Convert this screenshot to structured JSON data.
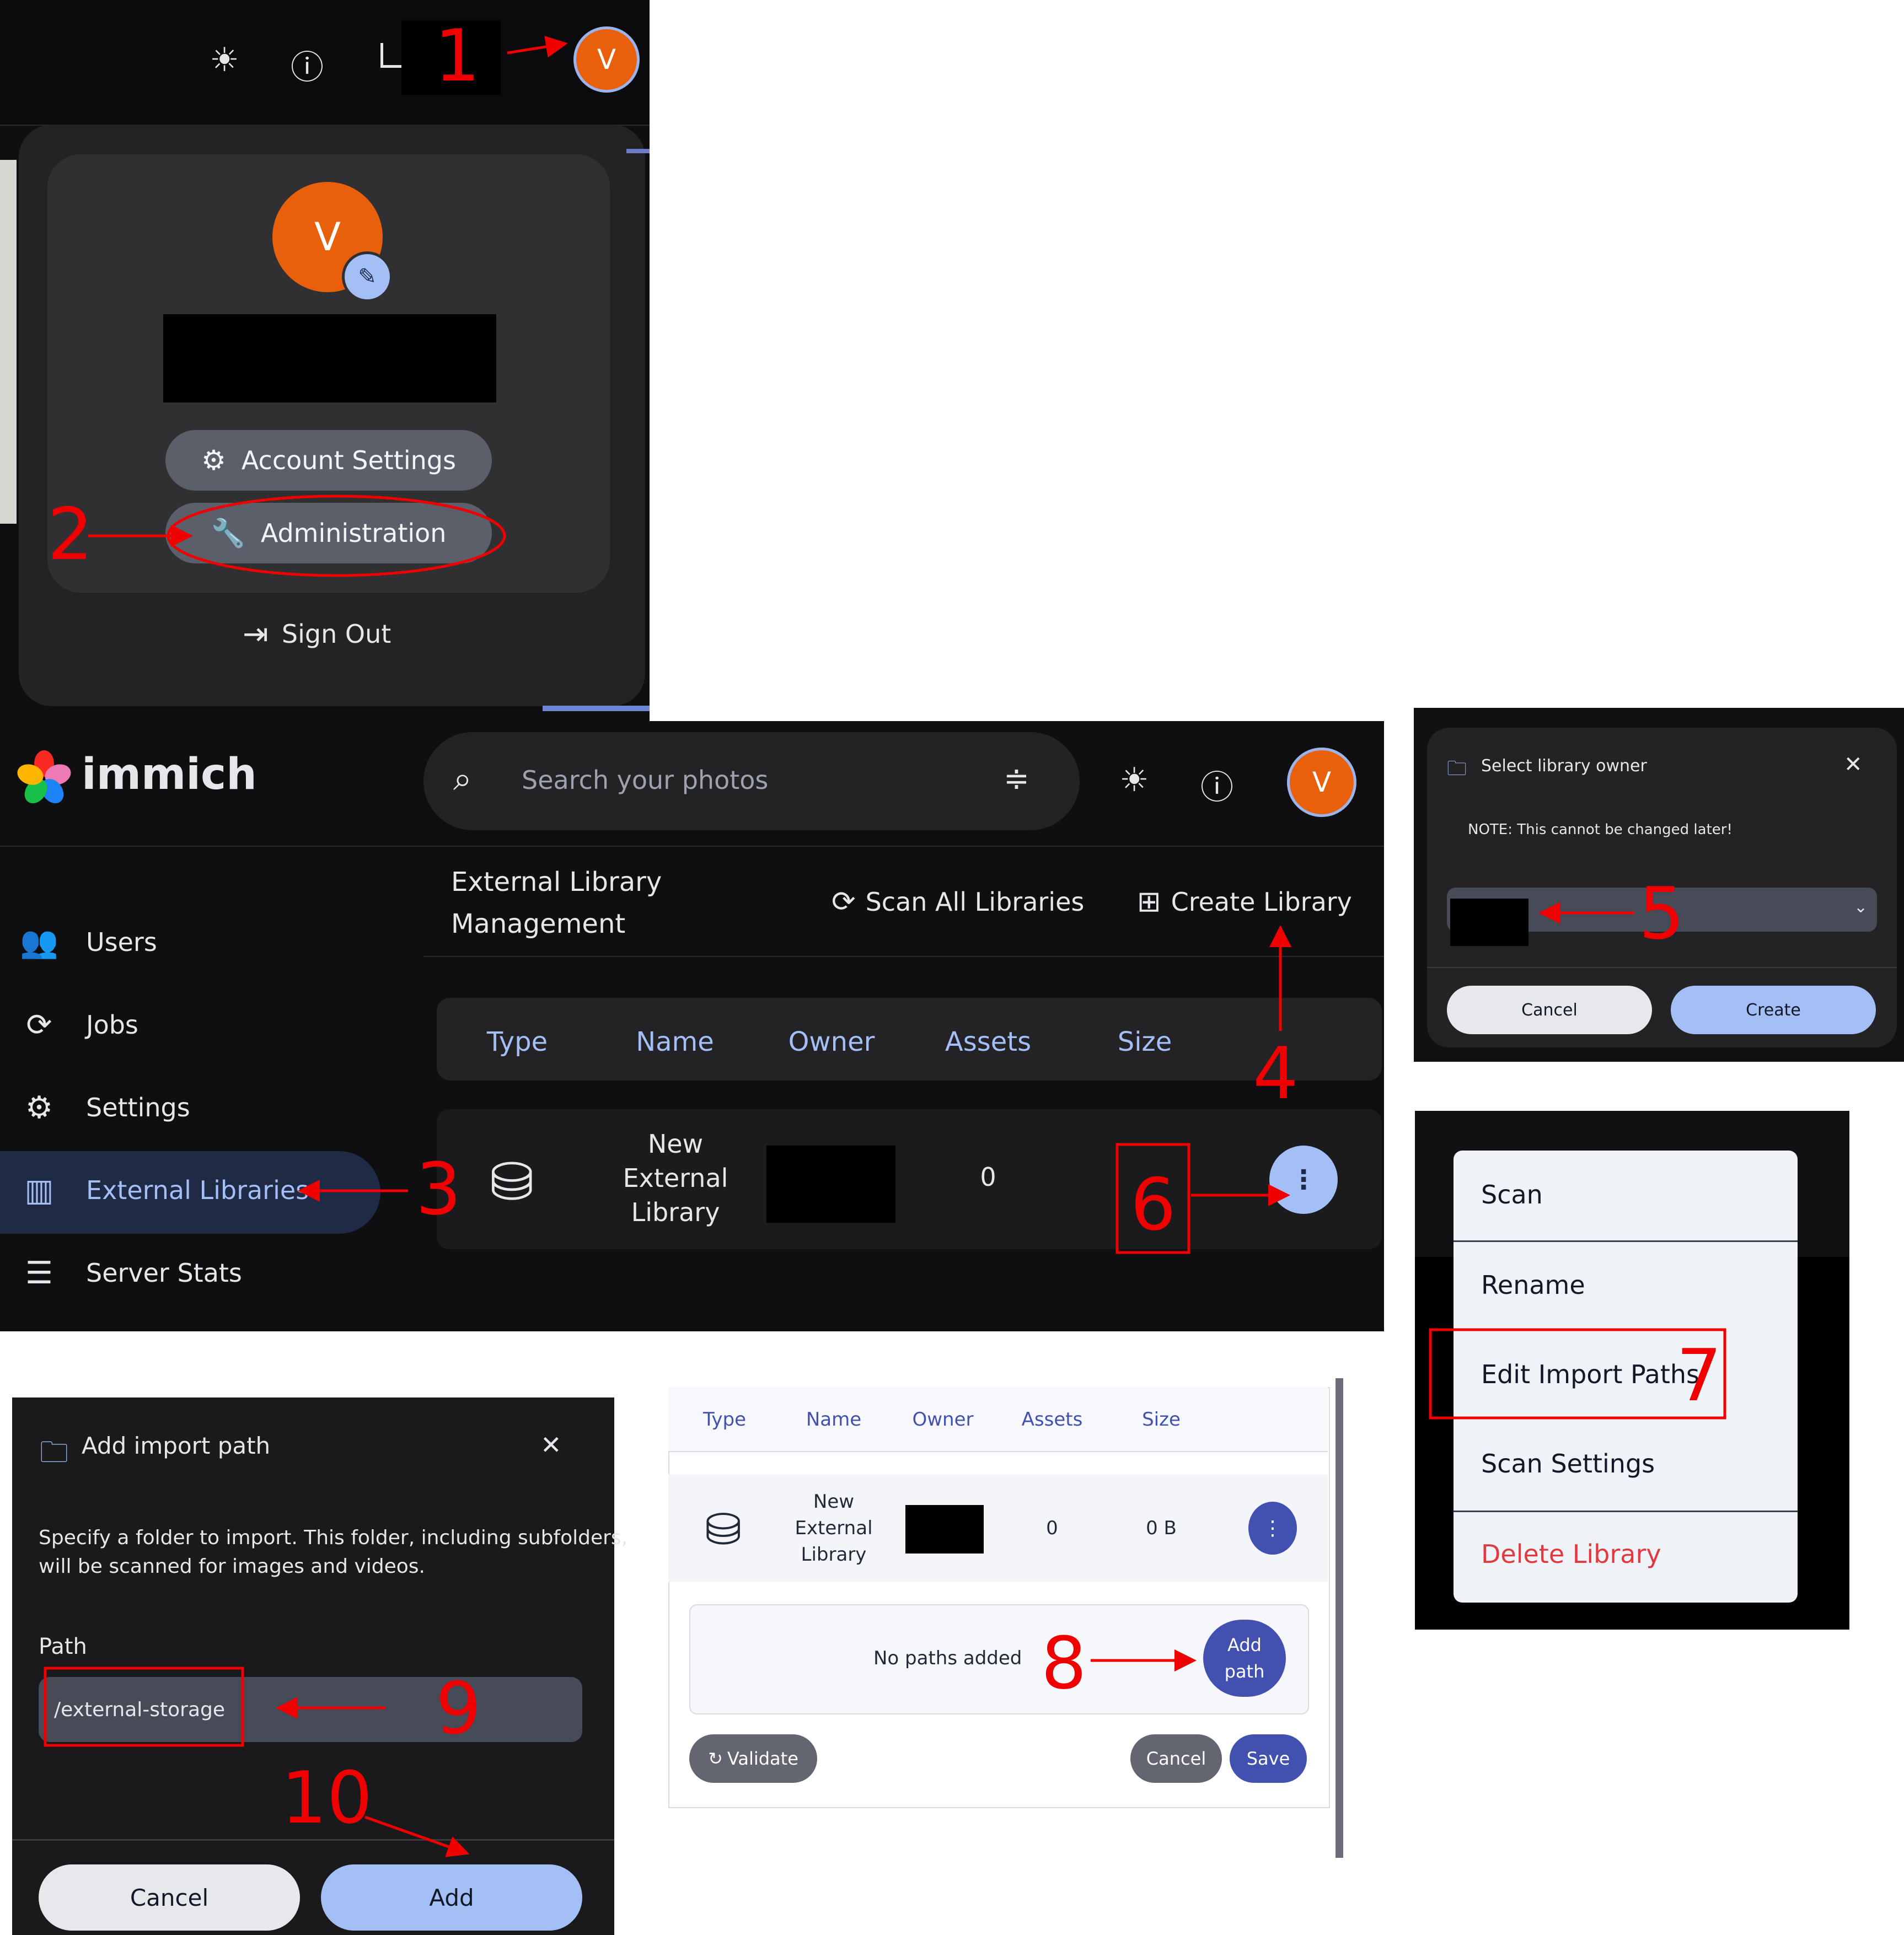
{
  "panel1": {
    "avatar_initial": "V",
    "big_avatar_initial": "V",
    "pencil_icon": "✎",
    "account_settings_label": "Account Settings",
    "administration_label": "Administration",
    "sign_out_label": "Sign Out"
  },
  "panel2": {
    "logo_text": "immich",
    "search_placeholder": "Search your photos",
    "avatar_initial": "V",
    "page_title_line1": "External Library",
    "page_title_line2": "Management",
    "scan_all_label": "Scan All Libraries",
    "create_library_label": "Create Library",
    "sidebar": [
      {
        "label": "Users",
        "icon": "users-icon"
      },
      {
        "label": "Jobs",
        "icon": "sync-icon"
      },
      {
        "label": "Settings",
        "icon": "gear-icon"
      },
      {
        "label": "External Libraries",
        "icon": "library-icon"
      },
      {
        "label": "Server Stats",
        "icon": "server-icon"
      }
    ],
    "columns": [
      "Type",
      "Name",
      "Owner",
      "Assets",
      "Size"
    ],
    "row": {
      "name_line1": "New",
      "name_line2": "External",
      "name_line3": "Library",
      "assets": "0"
    }
  },
  "panel3": {
    "title": "Select library owner",
    "note": "NOTE: This cannot be changed later!",
    "cancel": "Cancel",
    "create": "Create"
  },
  "panel4": {
    "items": [
      "Scan",
      "Rename",
      "Edit Import Paths",
      "Scan Settings",
      "Delete Library"
    ],
    "delete_color": "#e0393e"
  },
  "panel5": {
    "title": "Add import path",
    "desc_line1": "Specify a folder to import. This folder, including subfolders,",
    "desc_line2": "will be scanned for images and videos.",
    "path_label": "Path",
    "path_value": "/external-storage",
    "cancel": "Cancel",
    "add": "Add"
  },
  "panel6": {
    "columns": [
      "Type",
      "Name",
      "Owner",
      "Assets",
      "Size"
    ],
    "row": {
      "name_line1": "New",
      "name_line2": "External",
      "name_line3": "Library",
      "assets": "0",
      "size": "0 B"
    },
    "no_paths": "No paths added",
    "add_path_line1": "Add",
    "add_path_line2": "path",
    "validate": "Validate",
    "cancel": "Cancel",
    "save": "Save"
  },
  "annotations": [
    "1",
    "2",
    "3",
    "4",
    "5",
    "6",
    "7",
    "8",
    "9",
    "10"
  ],
  "colors": {
    "accent": "#a3bff5",
    "brand_dark": "#4250af",
    "avatar": "#e8600c",
    "annotation": "#f00000"
  }
}
